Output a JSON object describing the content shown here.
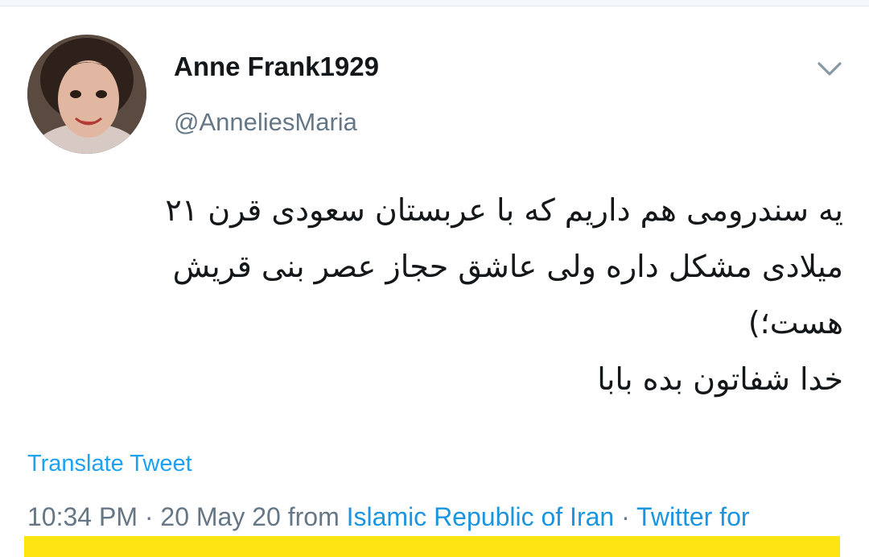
{
  "user": {
    "display_name": "Anne Frank1929",
    "handle": "@AnneliesMaria"
  },
  "tweet": {
    "lines": [
      "یه سندرومی هم داریم که با عربستان سعودی قرن ۲۱",
      "میلادی مشکل داره  ولی عاشق  حجاز عصر بنی قریش",
      "هست؛)",
      "خدا شفاتون بده بابا"
    ],
    "translate_label": "Translate Tweet"
  },
  "meta": {
    "time": "10:34 PM",
    "sep1": " · ",
    "date": "20 May 20",
    "from_word": " from ",
    "location": "Islamic Republic of Iran",
    "sep2": " · ",
    "source": "Twitter for"
  },
  "icons": {
    "menu": "chevron-down-icon",
    "avatar": "avatar-photo"
  },
  "colors": {
    "link": "#1da1f2",
    "secondary_text": "#657786",
    "highlight": "#ffe414"
  }
}
